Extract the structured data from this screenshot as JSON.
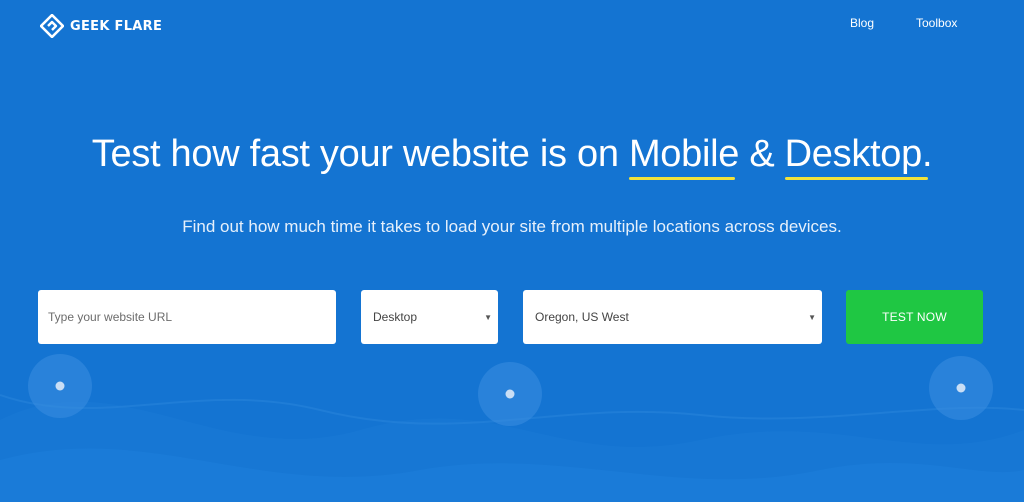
{
  "brand": {
    "name": "GEEK FLARE",
    "logo_icon": "geekflare-diamond-icon"
  },
  "nav": {
    "items": [
      {
        "label": "Blog"
      },
      {
        "label": "Toolbox"
      }
    ]
  },
  "hero": {
    "headline_prefix": "Test how fast your website is on ",
    "highlight_1": "Mobile",
    "headline_mid": " & ",
    "highlight_2": "Desktop.",
    "subheadline": "Find out how much time it takes to load your site from multiple locations across devices.",
    "underline_color": "#f2e23a"
  },
  "form": {
    "url_placeholder": "Type your website URL",
    "url_value": "",
    "device": {
      "selected": "Desktop",
      "arrow_icon": "caret-down-icon"
    },
    "location": {
      "selected": "Oregon, US West",
      "arrow_icon": "caret-down-icon"
    },
    "submit_label": "TEST NOW"
  },
  "colors": {
    "background": "#1474d2",
    "button": "#1fc743",
    "underline": "#f2e23a"
  }
}
